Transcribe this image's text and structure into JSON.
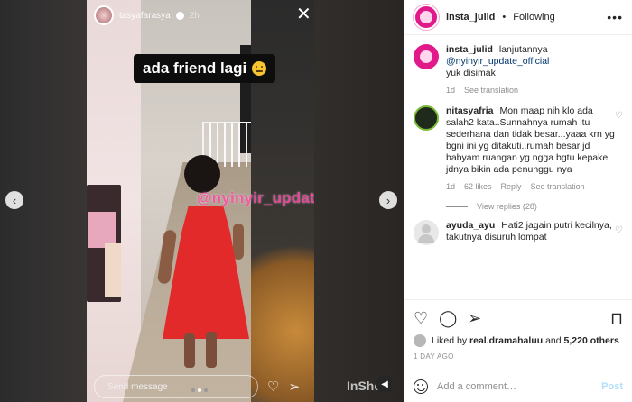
{
  "story": {
    "username": "tasyafarasya",
    "time": "2h",
    "caption": "ada friend lagi",
    "watermark": "@nyinyir_update_official",
    "message_placeholder": "Send message",
    "inshot_mark": "InShot"
  },
  "post": {
    "author": "insta_julid",
    "follow_status": "Following",
    "more_label": "•••",
    "caption": {
      "user": "insta_julid",
      "text": "lanjutannya",
      "mention": "@nyinyir_update_official",
      "text2": "yuk disimak",
      "age": "1d",
      "see_translation": "See translation"
    },
    "comments": [
      {
        "user": "nitasyafria",
        "text": "Mon maap nih klo ada salah2 kata..Sunnahnya rumah itu sederhana dan tidak besar...yaaa krn yg bgni ini yg ditakuti..rumah besar jd babyam ruangan yg ngga bgtu kepake jdnya bikin ada penunggu nya",
        "age": "1d",
        "likes": "62 likes",
        "reply": "Reply",
        "see_translation": "See translation",
        "view_replies": "View replies (28)"
      },
      {
        "user": "ayuda_ayu",
        "text": "Hati2 jagain putri kecilnya, takutnya disuruh lompat"
      }
    ],
    "likes": {
      "prefix": "Liked by",
      "user": "real.dramahaluu",
      "middle": "and",
      "others": "5,220 others"
    },
    "time_ago": "1 DAY AGO",
    "add_comment_placeholder": "Add a comment…",
    "post_label": "Post"
  },
  "colors": {
    "accent_pink": "#e2198a",
    "dress_red": "#e32a2a",
    "link_blue": "#00376b",
    "post_button": "#b2dffc"
  }
}
